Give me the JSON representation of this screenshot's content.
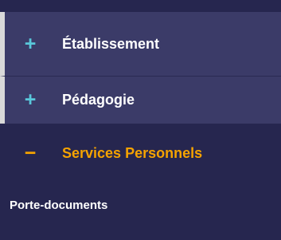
{
  "menu": {
    "items": [
      {
        "icon": "+",
        "label": "Établissement"
      },
      {
        "icon": "+",
        "label": "Pédagogie"
      },
      {
        "icon": "−",
        "label": "Services Personnels"
      }
    ],
    "sub_items": [
      {
        "label": "Porte-documents"
      }
    ]
  },
  "colors": {
    "background": "#26264f",
    "item_background": "#3b3b68",
    "plus_icon": "#59c7da",
    "active": "#f5a300",
    "text": "#ffffff"
  },
  "icons": {
    "collapsed": "plus-icon",
    "expanded": "minus-icon"
  }
}
